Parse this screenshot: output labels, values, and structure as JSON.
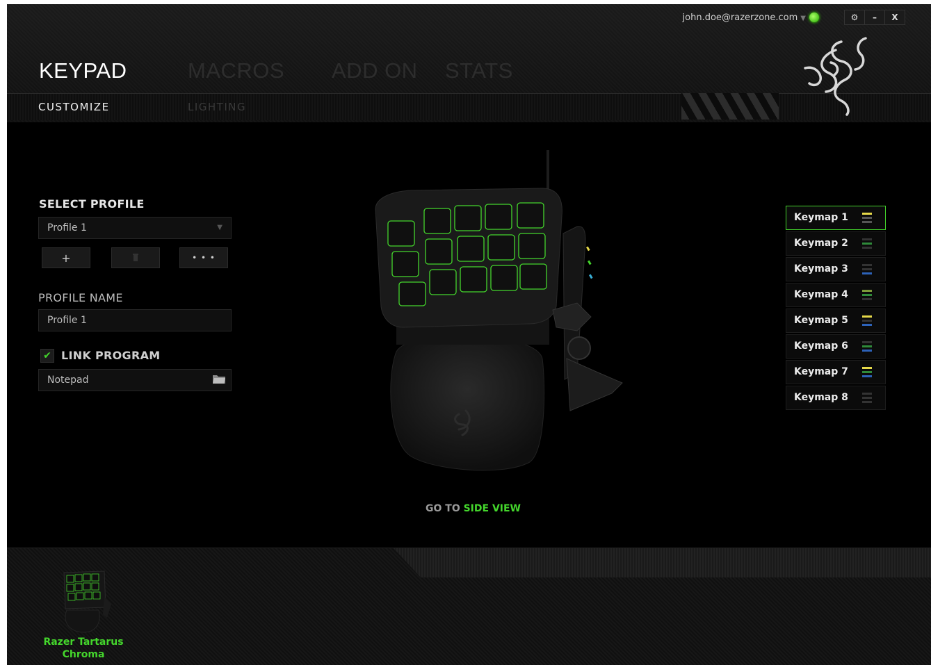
{
  "header": {
    "user_email": "john.doe@razerzone.com",
    "tabs": [
      {
        "label": "KEYPAD",
        "active": true
      },
      {
        "label": "MACROS",
        "active": false
      },
      {
        "label": "ADD ON",
        "active": false
      },
      {
        "label": "STATS",
        "active": false
      }
    ],
    "subtabs": [
      {
        "label": "CUSTOMIZE",
        "active": true
      },
      {
        "label": "LIGHTING",
        "active": false
      }
    ],
    "window_buttons": {
      "settings": "⚙",
      "minimize": "–",
      "close": "X"
    }
  },
  "profile": {
    "select_label": "SELECT PROFILE",
    "selected": "Profile 1",
    "buttons": {
      "add": "+",
      "more": "• • •"
    },
    "name_label": "PROFILE NAME",
    "name_value": "Profile 1",
    "link_program_label": "LINK PROGRAM",
    "link_program_checked": true,
    "program": "Notepad"
  },
  "device_view": {
    "go_to_prefix": "GO TO ",
    "go_to_link": "SIDE VIEW"
  },
  "keymaps": [
    {
      "label": "Keymap 1",
      "selected": true,
      "colors": [
        "#e6d94a",
        "#555555",
        "#555555"
      ]
    },
    {
      "label": "Keymap 2",
      "selected": false,
      "colors": [
        "#333333",
        "#2f8a3a",
        "#333333"
      ]
    },
    {
      "label": "Keymap 3",
      "selected": false,
      "colors": [
        "#333333",
        "#333333",
        "#2d62b8"
      ]
    },
    {
      "label": "Keymap 4",
      "selected": false,
      "colors": [
        "#7c9a3a",
        "#2f8a3a",
        "#333333"
      ]
    },
    {
      "label": "Keymap 5",
      "selected": false,
      "colors": [
        "#e6d94a",
        "#333333",
        "#2d62b8"
      ]
    },
    {
      "label": "Keymap 6",
      "selected": false,
      "colors": [
        "#333333",
        "#2f8a3a",
        "#2d62b8"
      ]
    },
    {
      "label": "Keymap 7",
      "selected": false,
      "colors": [
        "#e6d94a",
        "#2f8a3a",
        "#2d62b8"
      ]
    },
    {
      "label": "Keymap 8",
      "selected": false,
      "colors": [
        "#333333",
        "#333333",
        "#333333"
      ]
    }
  ],
  "footer": {
    "device_name_line1": "Razer Tartarus",
    "device_name_line2": "Chroma"
  },
  "colors": {
    "accent": "#44d62c",
    "background": "#000000"
  }
}
